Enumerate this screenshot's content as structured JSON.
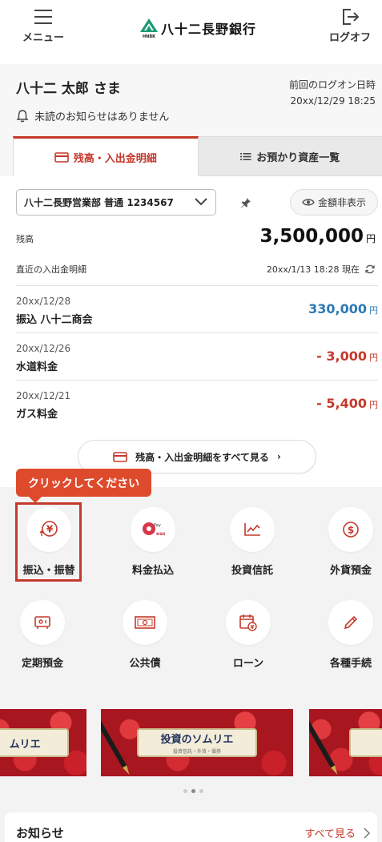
{
  "header": {
    "menu_label": "メニュー",
    "logo_text": "八十二長野銀行",
    "logo_mark": "HNBK",
    "logout_label": "ログオフ"
  },
  "user": {
    "name": "八十二 太郎 さま",
    "last_login_label": "前回のログオン日時",
    "last_login_time": "20xx/12/29 18:25",
    "notice": "未読のお知らせはありません"
  },
  "tabs": [
    {
      "label": "残高・入出金明細",
      "active": true
    },
    {
      "label": "お預かり資産一覧",
      "active": false
    }
  ],
  "account": {
    "selected": "八十二長野営業部 普通 1234567",
    "hide_label": "金額非表示",
    "balance_label": "残高",
    "balance": "3,500,000",
    "yen": "円",
    "recent_label": "直近の入出金明細",
    "recent_time": "20xx/1/13 18:28 現在"
  },
  "transactions": [
    {
      "date": "20xx/12/28",
      "desc": "振込 八十二商会",
      "amount": "330,000",
      "type": "in"
    },
    {
      "date": "20xx/12/26",
      "desc": "水道料金",
      "amount": "- 3,000",
      "type": "out"
    },
    {
      "date": "20xx/12/21",
      "desc": "ガス料金",
      "amount": "- 5,400",
      "type": "out"
    }
  ],
  "view_all_label": "残高・入出金明細をすべて見る",
  "tooltip": "クリックしてください",
  "menu": [
    {
      "label": "振込・振替",
      "icon": "transfer-yen-icon"
    },
    {
      "label": "料金払込",
      "icon": "pay-easy-icon"
    },
    {
      "label": "投資信託",
      "icon": "chart-line-icon"
    },
    {
      "label": "外貨預金",
      "icon": "dollar-icon"
    },
    {
      "label": "定期預金",
      "icon": "safe-icon"
    },
    {
      "label": "公共債",
      "icon": "bond-icon"
    },
    {
      "label": "ローン",
      "icon": "calendar-yen-icon"
    },
    {
      "label": "各種手続",
      "icon": "pencil-icon"
    }
  ],
  "banners": [
    {
      "title": "ムリエ"
    },
    {
      "title": "投資のソムリエ",
      "sub": "投資信託・外貨・債券"
    },
    {
      "title": ""
    }
  ],
  "news": {
    "title": "お知らせ",
    "view_all": "すべて見る"
  },
  "colors": {
    "accent": "#c5392b",
    "positive": "#2c79b4",
    "tooltip": "#de4b2c"
  }
}
